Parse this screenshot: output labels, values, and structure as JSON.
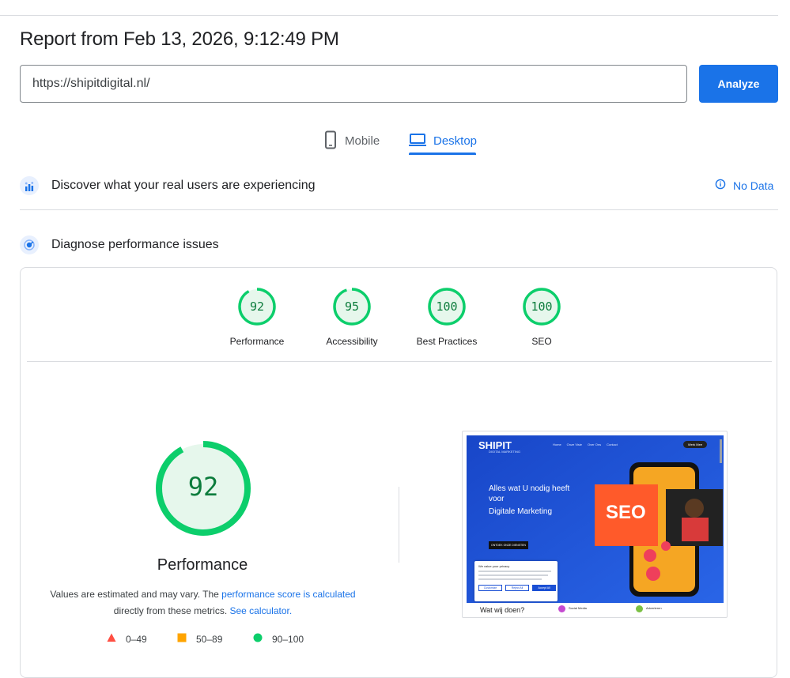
{
  "report": {
    "title": "Report from Feb 13, 2026, 9:12:49 PM"
  },
  "search": {
    "url": "https://shipitdigital.nl/",
    "analyze_label": "Analyze"
  },
  "tabs": [
    {
      "label": "Mobile",
      "icon": "smartphone-icon",
      "active": false
    },
    {
      "label": "Desktop",
      "icon": "laptop-icon",
      "active": true
    }
  ],
  "real_users": {
    "title": "Discover what your real users are experiencing",
    "status": "No Data",
    "icon": "crux-chart-icon"
  },
  "diagnose": {
    "title": "Diagnose performance issues",
    "icon": "lighthouse-icon"
  },
  "scores": [
    {
      "value": "92",
      "label": "Performance",
      "fraction": 0.92
    },
    {
      "value": "95",
      "label": "Accessibility",
      "fraction": 0.95
    },
    {
      "value": "100",
      "label": "Best Practices",
      "fraction": 1.0
    },
    {
      "value": "100",
      "label": "SEO",
      "fraction": 1.0
    }
  ],
  "performance": {
    "score": "92",
    "fraction": 0.92,
    "title": "Performance",
    "desc_before": "Values are estimated and may vary. The ",
    "desc_link1": "performance score is calculated",
    "desc_middle": " directly from these metrics. ",
    "desc_link2": "See calculator."
  },
  "legend": [
    {
      "range": "0–49",
      "shape": "triangle",
      "color": "#ff4e42"
    },
    {
      "range": "50–89",
      "shape": "square",
      "color": "#ffa400"
    },
    {
      "range": "90–100",
      "shape": "circle",
      "color": "#0cce6b"
    }
  ],
  "screenshot": {
    "brand": "SHIPIT",
    "brand_sub": "DIGITAL MARKETING",
    "nav": [
      "Home",
      "Onze Visie",
      "Over Ons",
      "Contact"
    ],
    "cta": "Werk Mee",
    "headline_1": "Alles wat U nodig heeft",
    "headline_2": "voor",
    "headline_3": "Digitale Marketing",
    "hero_button": "ONTDEK ONZE DIENSTEN",
    "seo_badge": "SEO",
    "cookie_title": "We value your privacy",
    "cookie_buttons": [
      "Customize",
      "Reject All",
      "Accept All"
    ],
    "bottom_text": "Wat wij doen?",
    "service_1": "Social Media",
    "service_2": "Adverteren"
  },
  "colors": {
    "accent": "#1a73e8",
    "pass": "#0cce6b",
    "pass_text": "#0c7c3c",
    "pass_fill": "#e6f7ec"
  }
}
